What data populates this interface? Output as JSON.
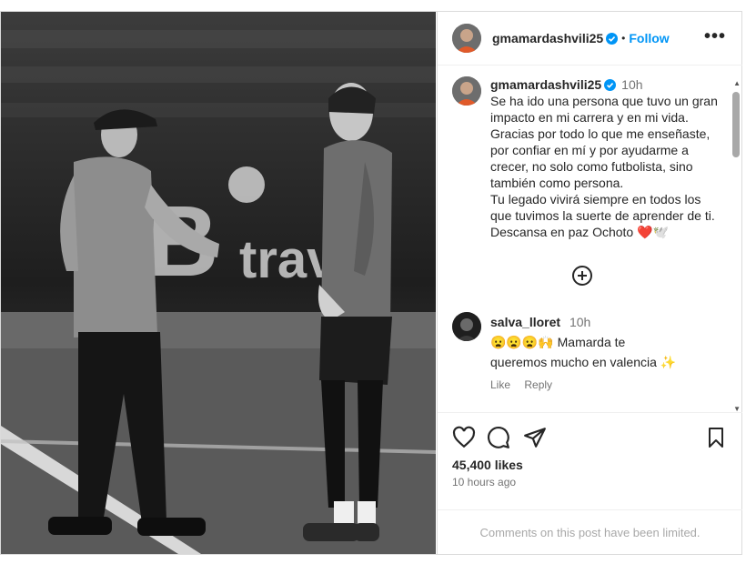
{
  "post": {
    "author": "gmamardashvili25",
    "follow_label": "Follow",
    "separator": "•",
    "more_label": "•••"
  },
  "caption": {
    "author": "gmamardashvili25",
    "time": "10h",
    "text": "Se ha ido una persona que tuvo un gran impacto en mi carrera y en mi vida.\nGracias por todo lo que me enseñaste, por confiar en mí y por ayudarme a crecer, no solo como futbolista, sino también como persona.\nTu legado vivirá siempre en todos los que tuvimos la suerte de aprender de ti.\nDescansa en paz Ochoto",
    "trailing_emoji": "❤️🕊️"
  },
  "comment": {
    "author": "salva_lloret",
    "time": "10h",
    "emoji_prefix": "😦😦😦🙌",
    "text_line1": "Mamarda te",
    "text_line2": "queremos mucho en valencia",
    "emoji_suffix": "✨",
    "like_label": "Like",
    "reply_label": "Reply"
  },
  "stats": {
    "likes": "45,400 likes",
    "time_ago": "10 hours ago",
    "comments_limited": "Comments on this post have been limited."
  },
  "image": {
    "banner_text": "B travel",
    "accent_color": "#0095f6",
    "verified_color": "#0095f6"
  }
}
